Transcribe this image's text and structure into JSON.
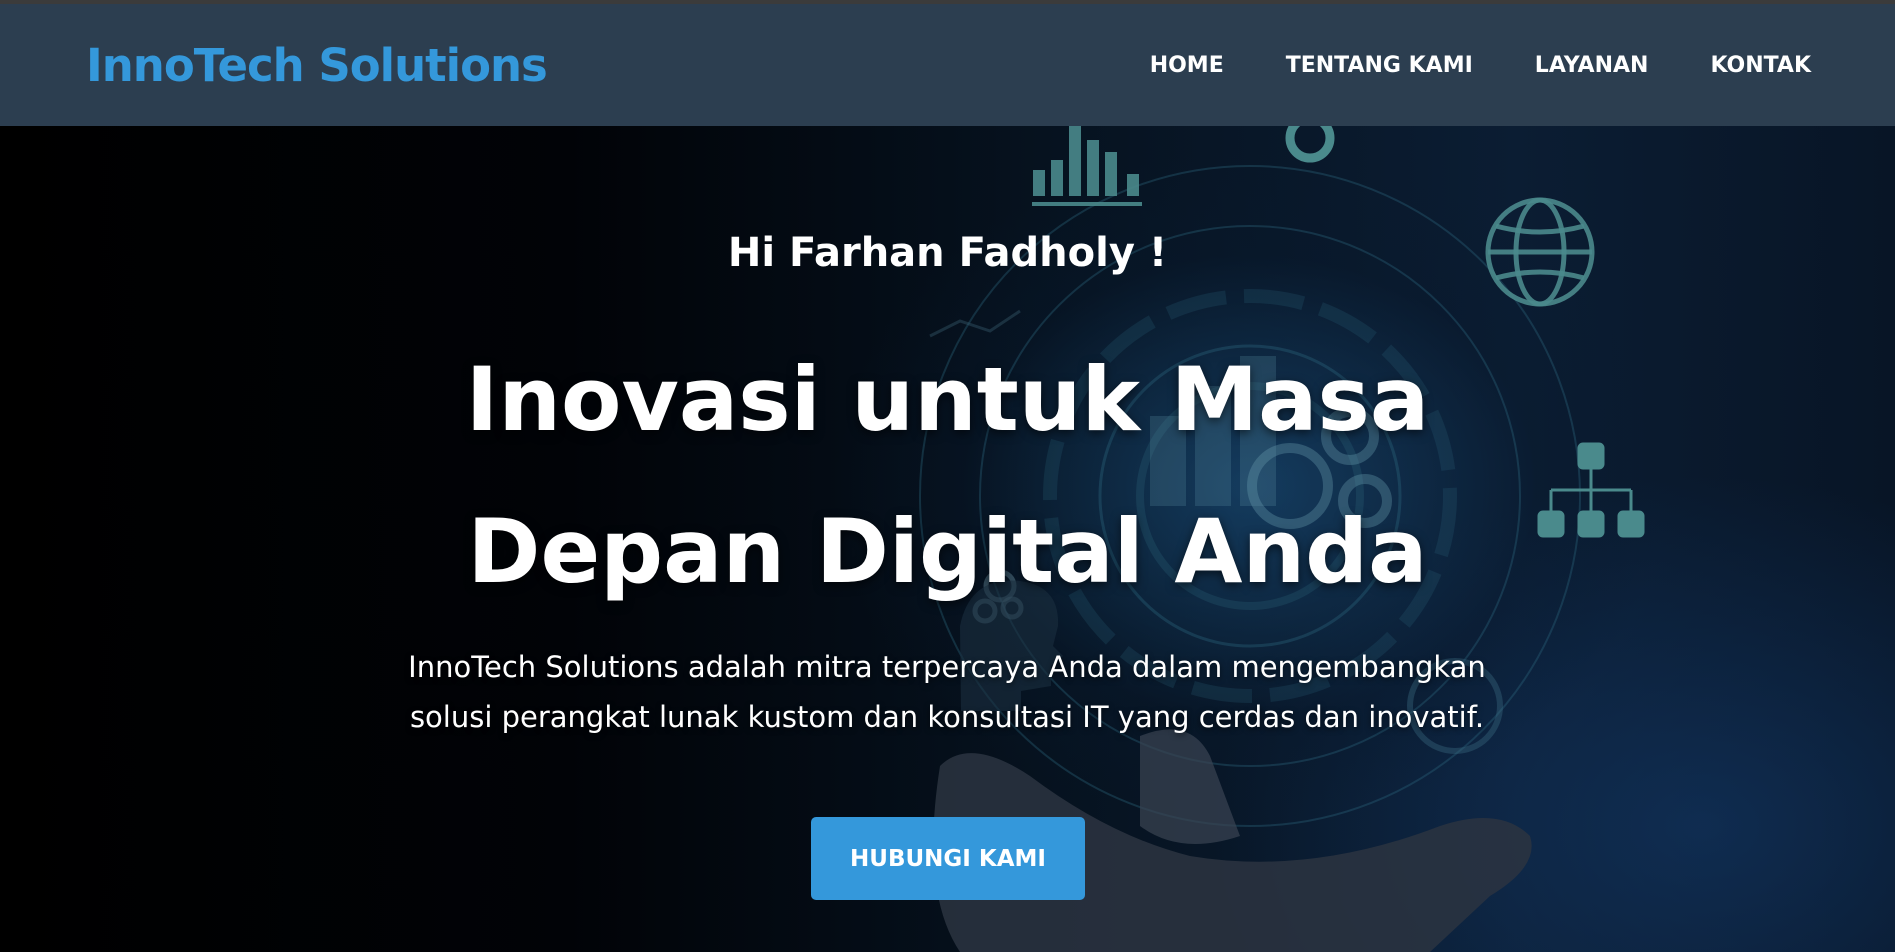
{
  "brand": {
    "name": "InnoTech Solutions"
  },
  "nav": {
    "items": [
      "HOME",
      "TENTANG KAMI",
      "LAYANAN",
      "KONTAK"
    ]
  },
  "hero": {
    "greeting": "Hi Farhan Fadholy !",
    "headline_line1": "Inovasi untuk Masa",
    "headline_line2": "Depan Digital Anda",
    "subtext_line1": "InnoTech Solutions adalah mitra terpercaya Anda dalam mengembangkan",
    "subtext_line2": "solusi perangkat lunak kustom dan konsultasi IT yang cerdas dan inovatif.",
    "cta_label": "HUBUNGI KAMI"
  },
  "background_icons": [
    "bar-chart-icon",
    "gear-icon",
    "globe-icon",
    "org-chart-icon",
    "hand-image"
  ],
  "colors": {
    "navbar": "#2c3e50",
    "brand": "#3498db",
    "cta": "#3498db",
    "icon_teal": "#4a8a8c"
  }
}
